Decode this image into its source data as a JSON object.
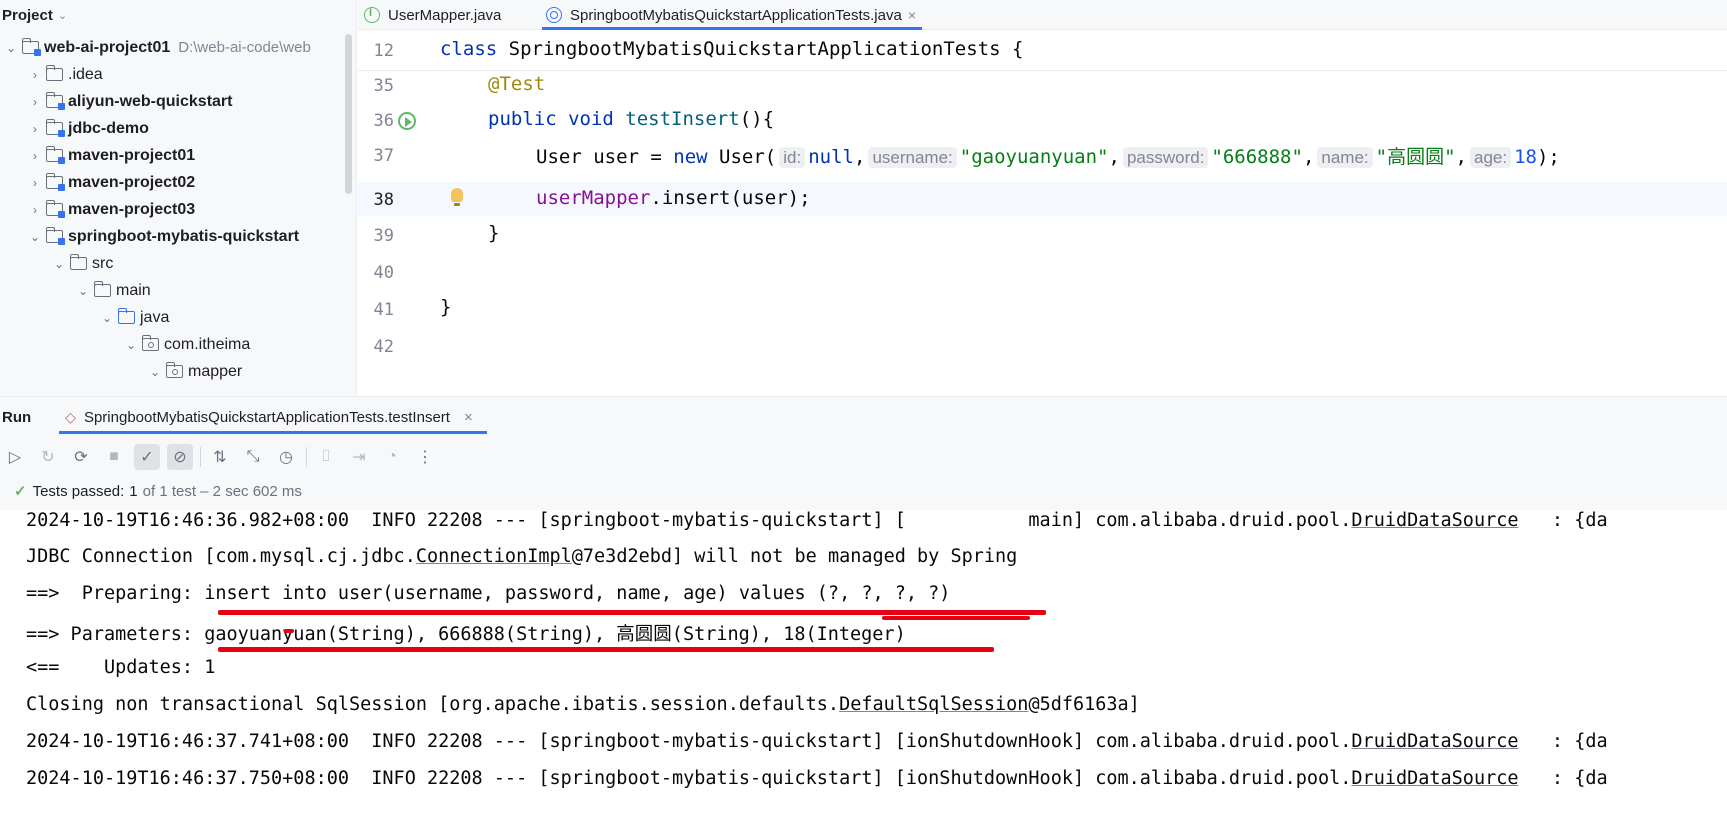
{
  "project": {
    "title": "Project",
    "items": [
      {
        "label": "web-ai-project01",
        "path": "D:\\web-ai-code\\web",
        "arrow": "expanded"
      },
      {
        "label": ".idea"
      },
      {
        "label": "aliyun-web-quickstart"
      },
      {
        "label": "jdbc-demo"
      },
      {
        "label": "maven-project01"
      },
      {
        "label": "maven-project02"
      },
      {
        "label": "maven-project03"
      },
      {
        "label": "springboot-mybatis-quickstart"
      },
      {
        "label": "src"
      },
      {
        "label": "main"
      },
      {
        "label": "java"
      },
      {
        "label": "com.itheima"
      },
      {
        "label": "mapper"
      }
    ]
  },
  "editor": {
    "tabs": [
      {
        "label": "UserMapper.java"
      },
      {
        "label": "SpringbootMybatisQuickstartApplicationTests.java",
        "close": "×"
      }
    ],
    "sticky": {
      "lineno": "12",
      "kw": "class",
      "text": "SpringbootMybatisQuickstartApplicationTests {"
    },
    "lines": [
      {
        "no": "35",
        "annotation": "@Test"
      },
      {
        "no": "36",
        "kw": "public void",
        "fn": "testInsert",
        "rest": "(){"
      },
      {
        "no": "37",
        "text1": "User user = ",
        "kw": "new",
        "text2": " User(",
        "hint_id": "id:",
        "null": "null",
        "comma1": ",",
        "hint_username": "username:",
        "str_username": "\"gaoyuanyuan\"",
        "comma2": ",",
        "hint_password": "password:",
        "str_password": "\"666888\"",
        "comma3": ",",
        "hint_name": "name:",
        "str_name": "\"高圆圆\"",
        "comma4": ",",
        "hint_age": "age:",
        "num_age": "18",
        "end": ");"
      },
      {
        "no": "38",
        "field": "userMapper",
        "rest": ".insert(user);"
      },
      {
        "no": "39",
        "text": "}"
      },
      {
        "no": "40",
        "text": ""
      },
      {
        "no": "41",
        "text": "}"
      },
      {
        "no": "42",
        "text": ""
      }
    ]
  },
  "run": {
    "title": "Run",
    "tab": "SpringbootMybatisQuickstartApplicationTests.testInsert",
    "tab_close": "×",
    "status": {
      "passed_label": "Tests passed:",
      "passed_count": "1",
      "rest": "of 1 test – 2 sec 602 ms"
    },
    "console": [
      {
        "pre": "2024-10-19T16:46:36.982+08:00  INFO 22208 --- [springboot-mybatis-quickstart] [           main] com.alibaba.druid.pool.",
        "ul": "DruidDataSource",
        "post": "   : {da"
      },
      {
        "pre": "JDBC Connection [com.mysql.cj.jdbc.",
        "ul": "ConnectionImpl",
        "post": "@7e3d2ebd] will not be managed by Spring"
      },
      {
        "text": "==>  Preparing: insert into user(username, password, name, age) values (?, ?, ?, ?)"
      },
      {
        "text": "==> Parameters: gaoyuanyuan(String), 666888(String), 高圆圆(String), 18(Integer)"
      },
      {
        "text": "<==    Updates: 1"
      },
      {
        "pre": "Closing non transactional SqlSession [org.apache.ibatis.session.defaults.",
        "ul": "DefaultSqlSession",
        "post": "@5df6163a]"
      },
      {
        "pre": "2024-10-19T16:46:37.741+08:00  INFO 22208 --- [springboot-mybatis-quickstart] [ionShutdownHook] com.alibaba.druid.pool.",
        "ul": "DruidDataSource",
        "post": "   : {da"
      },
      {
        "pre": "2024-10-19T16:46:37.750+08:00  INFO 22208 --- [springboot-mybatis-quickstart] [ionShutdownHook] com.alibaba.druid.pool.",
        "ul": "DruidDataSource",
        "post": "   : {da"
      }
    ]
  },
  "colors": {
    "accent": "#3574f0",
    "pass": "#5fb865",
    "highlight": "#e60012"
  }
}
